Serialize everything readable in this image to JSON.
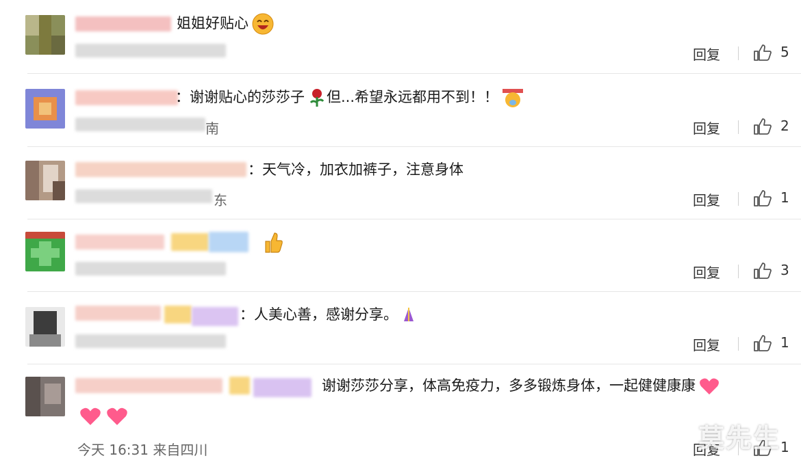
{
  "comments": [
    {
      "text": "姐姐好贴心",
      "prefix": "",
      "meta": "",
      "reply": "回复",
      "likes": "5",
      "emoji": "laughing-emoji"
    },
    {
      "text": "谢谢贴心的莎莎子",
      "text2": "但...希望永远都用不到！！",
      "prefix": "：",
      "meta": "南",
      "reply": "回复",
      "likes": "2",
      "emoji": "rose-emoji"
    },
    {
      "text": "天气冷，加衣加裤子，注意身体",
      "prefix": "：",
      "meta": "东",
      "reply": "回复",
      "likes": "1"
    },
    {
      "text": "",
      "prefix": "",
      "meta": "",
      "reply": "回复",
      "likes": "3",
      "emoji": "thumbs-up-emoji"
    },
    {
      "text": "人美心善，感谢分享。",
      "prefix": "：",
      "meta": "",
      "reply": "回复",
      "likes": "1",
      "emoji": "pray-emoji"
    },
    {
      "text": "谢谢莎莎分享，体高免疫力，多多锻炼身体，一起健健康康",
      "prefix": "",
      "meta": "今天 16:31 来自四川",
      "reply": "回复",
      "likes": "1",
      "emoji": "heart-emoji"
    }
  ],
  "watermark": "莫先生"
}
